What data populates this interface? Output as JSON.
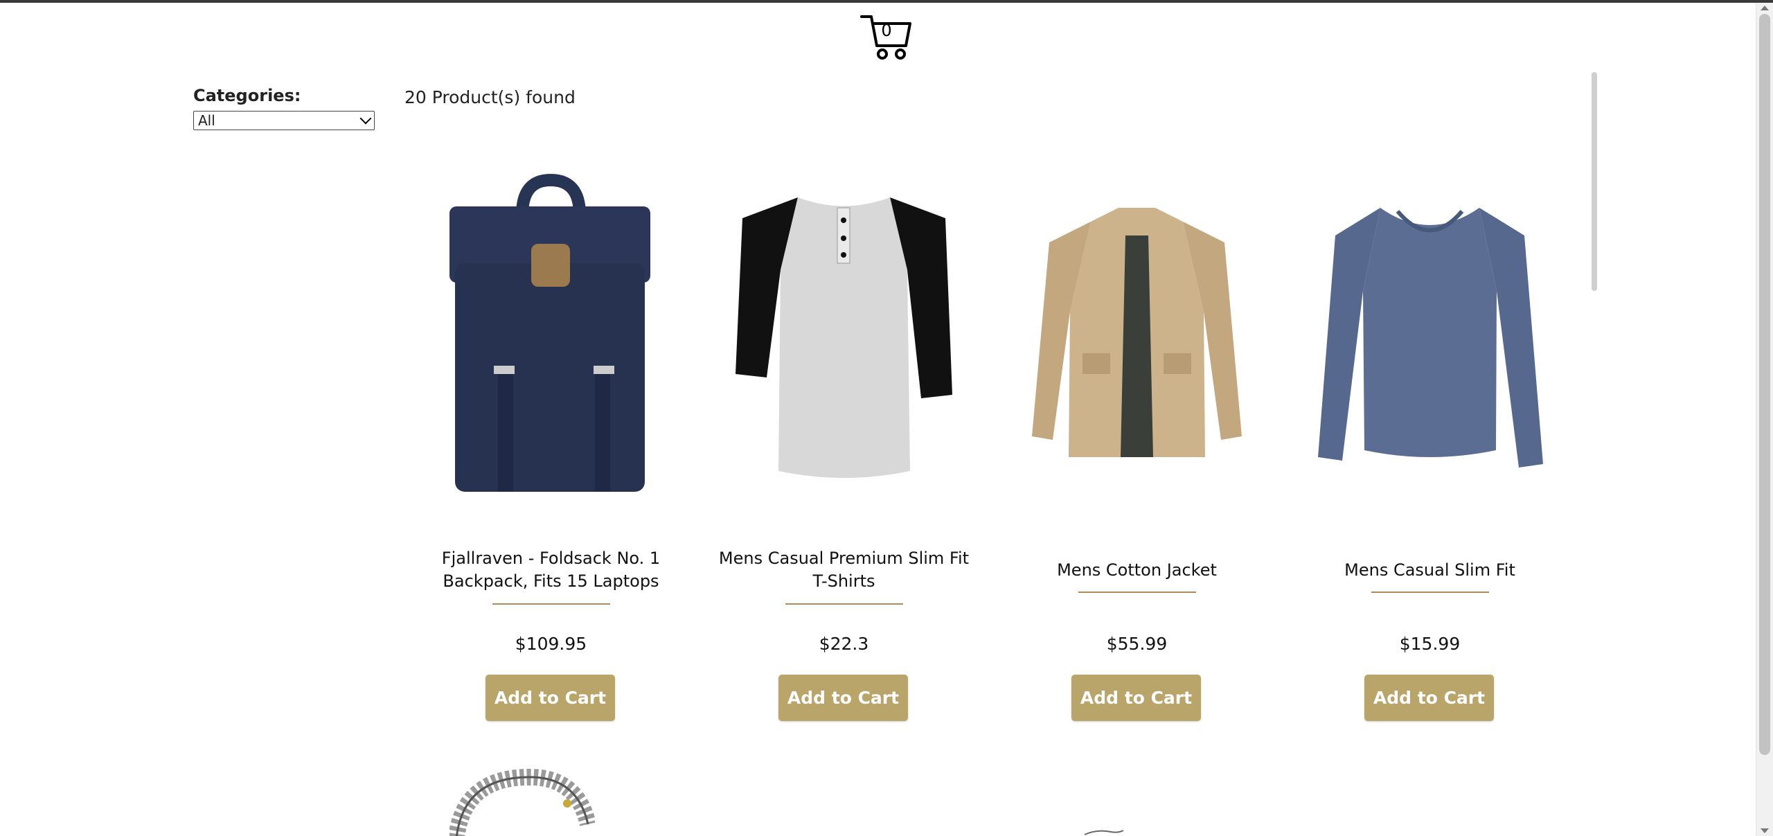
{
  "header": {
    "cart_count": "0"
  },
  "filters": {
    "categories_label": "Categories:",
    "selected": "All"
  },
  "results_text": "20 Product(s) found",
  "products": [
    {
      "title": "Fjallraven - Foldsack No. 1 Backpack, Fits 15 Laptops",
      "price": "$109.95",
      "button": "Add to Cart",
      "image": "backpack-image"
    },
    {
      "title": "Mens Casual Premium Slim Fit T-Shirts",
      "price": "$22.3",
      "button": "Add to Cart",
      "image": "tshirt-image"
    },
    {
      "title": "Mens Cotton Jacket",
      "price": "$55.99",
      "button": "Add to Cart",
      "image": "jacket-image"
    },
    {
      "title": "Mens Casual Slim Fit",
      "price": "$15.99",
      "button": "Add to Cart",
      "image": "longsleeve-image"
    }
  ],
  "colors": {
    "accent": "#b9a46a",
    "divider": "#b08a55",
    "backpack": "#283453",
    "tee_body": "#d8d8d8",
    "tee_sleeve": "#111111",
    "jacket": "#cdb38c",
    "shirt": "#5b6d93"
  }
}
